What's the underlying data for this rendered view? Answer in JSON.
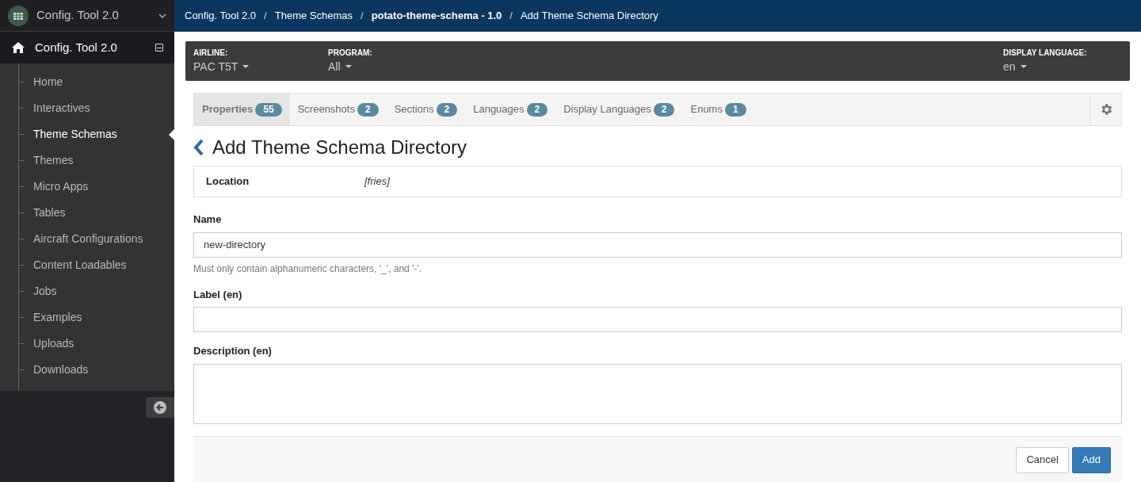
{
  "app_switcher": {
    "title": "Config. Tool 2.0"
  },
  "sidebar": {
    "root": {
      "label": "Config. Tool 2.0",
      "expanded": true
    },
    "items": [
      {
        "label": "Home",
        "selected": false
      },
      {
        "label": "Interactives",
        "selected": false
      },
      {
        "label": "Theme Schemas",
        "selected": true
      },
      {
        "label": "Themes",
        "selected": false
      },
      {
        "label": "Micro Apps",
        "selected": false
      },
      {
        "label": "Tables",
        "selected": false
      },
      {
        "label": "Aircraft Configurations",
        "selected": false
      },
      {
        "label": "Content Loadables",
        "selected": false
      },
      {
        "label": "Jobs",
        "selected": false
      },
      {
        "label": "Examples",
        "selected": false
      },
      {
        "label": "Uploads",
        "selected": false
      },
      {
        "label": "Downloads",
        "selected": false
      }
    ]
  },
  "breadcrumbs": [
    {
      "label": "Config. Tool 2.0",
      "bold": false
    },
    {
      "label": "Theme Schemas",
      "bold": false
    },
    {
      "label": "potato-theme-schema - 1.0",
      "bold": true
    },
    {
      "label": "Add Theme Schema Directory",
      "bold": false
    }
  ],
  "breadcrumb_separator": "/",
  "filters": [
    {
      "label": "AIRLINE:",
      "value": "PAC T5T"
    },
    {
      "label": "PROGRAM:",
      "value": "All"
    },
    {
      "label": "DISPLAY LANGUAGE:",
      "value": "en"
    }
  ],
  "tabs": [
    {
      "label": "Properties",
      "count": "55",
      "selected": true
    },
    {
      "label": "Screenshots",
      "count": "2",
      "selected": false
    },
    {
      "label": "Sections",
      "count": "2",
      "selected": false
    },
    {
      "label": "Languages",
      "count": "2",
      "selected": false
    },
    {
      "label": "Display Languages",
      "count": "2",
      "selected": false
    },
    {
      "label": "Enums",
      "count": "1",
      "selected": false
    }
  ],
  "heading": "Add Theme Schema Directory",
  "location": {
    "label": "Location",
    "value": "[fries]"
  },
  "fields": [
    {
      "kind": "input",
      "label": "Name",
      "value": "new-directory",
      "help": "Must only contain alphanumeric characters, '_', and '-'."
    },
    {
      "kind": "input",
      "label": "Label (en)"
    },
    {
      "kind": "textarea",
      "label": "Description (en)"
    }
  ],
  "buttons": [
    {
      "label": "Cancel",
      "kind": "default"
    },
    {
      "label": "Add",
      "kind": "primary"
    }
  ]
}
